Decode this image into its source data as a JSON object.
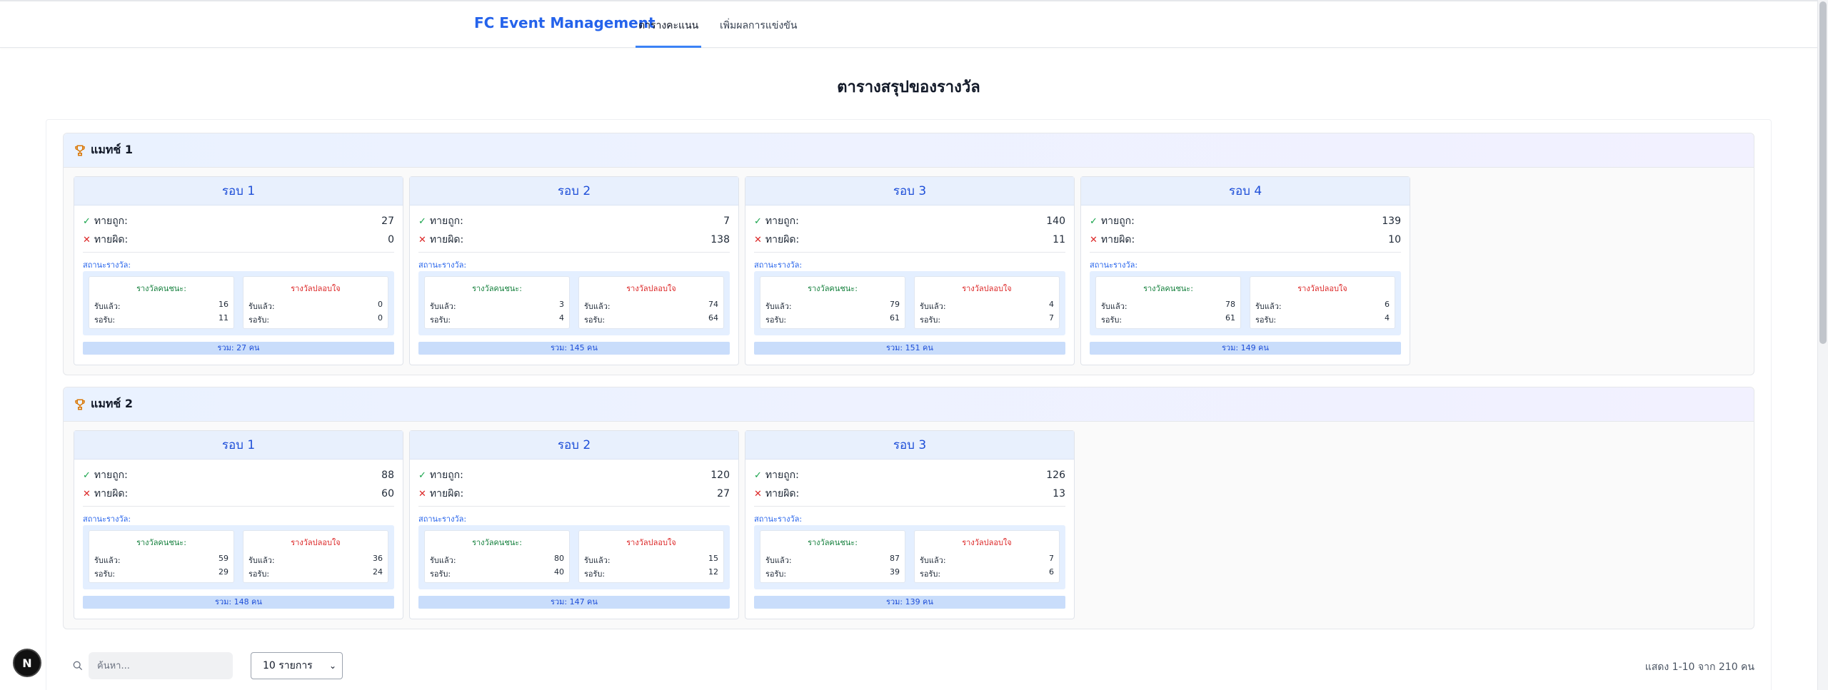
{
  "nav": {
    "brand": "FC Event Management",
    "tabs": [
      {
        "label": "ตารางคะแนน",
        "active": true
      },
      {
        "label": "เพิ่มผลการแข่งขัน",
        "active": false
      }
    ]
  },
  "page_title": "ตารางสรุปของรางวัล",
  "labels": {
    "correct": "ทายถูก:",
    "wrong": "ทายผิด:",
    "status": "สถานะรางวัล:",
    "winner_award": "รางวัลคนชนะ:",
    "consolation_award": "รางวัลปลอบใจ",
    "received": "รับแล้ว:",
    "waiting": "รอรับ:"
  },
  "matches": [
    {
      "title": "แมทช์ 1",
      "rounds": [
        {
          "title": "รอบ 1",
          "correct": "27",
          "wrong": "0",
          "win_received": "16",
          "win_waiting": "11",
          "con_received": "0",
          "con_waiting": "0",
          "total": "รวม: 27 คน"
        },
        {
          "title": "รอบ 2",
          "correct": "7",
          "wrong": "138",
          "win_received": "3",
          "win_waiting": "4",
          "con_received": "74",
          "con_waiting": "64",
          "total": "รวม: 145 คน"
        },
        {
          "title": "รอบ 3",
          "correct": "140",
          "wrong": "11",
          "win_received": "79",
          "win_waiting": "61",
          "con_received": "4",
          "con_waiting": "7",
          "total": "รวม: 151 คน"
        },
        {
          "title": "รอบ 4",
          "correct": "139",
          "wrong": "10",
          "win_received": "78",
          "win_waiting": "61",
          "con_received": "6",
          "con_waiting": "4",
          "total": "รวม: 149 คน"
        }
      ]
    },
    {
      "title": "แมทช์ 2",
      "rounds": [
        {
          "title": "รอบ 1",
          "correct": "88",
          "wrong": "60",
          "win_received": "59",
          "win_waiting": "29",
          "con_received": "36",
          "con_waiting": "24",
          "total": "รวม: 148 คน"
        },
        {
          "title": "รอบ 2",
          "correct": "120",
          "wrong": "27",
          "win_received": "80",
          "win_waiting": "40",
          "con_received": "15",
          "con_waiting": "12",
          "total": "รวม: 147 คน"
        },
        {
          "title": "รอบ 3",
          "correct": "126",
          "wrong": "13",
          "win_received": "87",
          "win_waiting": "39",
          "con_received": "7",
          "con_waiting": "6",
          "total": "รวม: 139 คน"
        }
      ]
    }
  ],
  "table_controls": {
    "search_placeholder": "ค้นหา...",
    "page_size": "10 รายการ",
    "showing": "แสดง 1-10 จาก 210 คน"
  },
  "badge": "N",
  "colors": {
    "primary": "#2563eb",
    "correct": "#16a34a",
    "wrong": "#dc2626",
    "trophy": "#d97706"
  },
  "icons": [
    "trophy-icon",
    "check-icon",
    "cross-icon",
    "search-icon",
    "chevron-down-icon"
  ]
}
